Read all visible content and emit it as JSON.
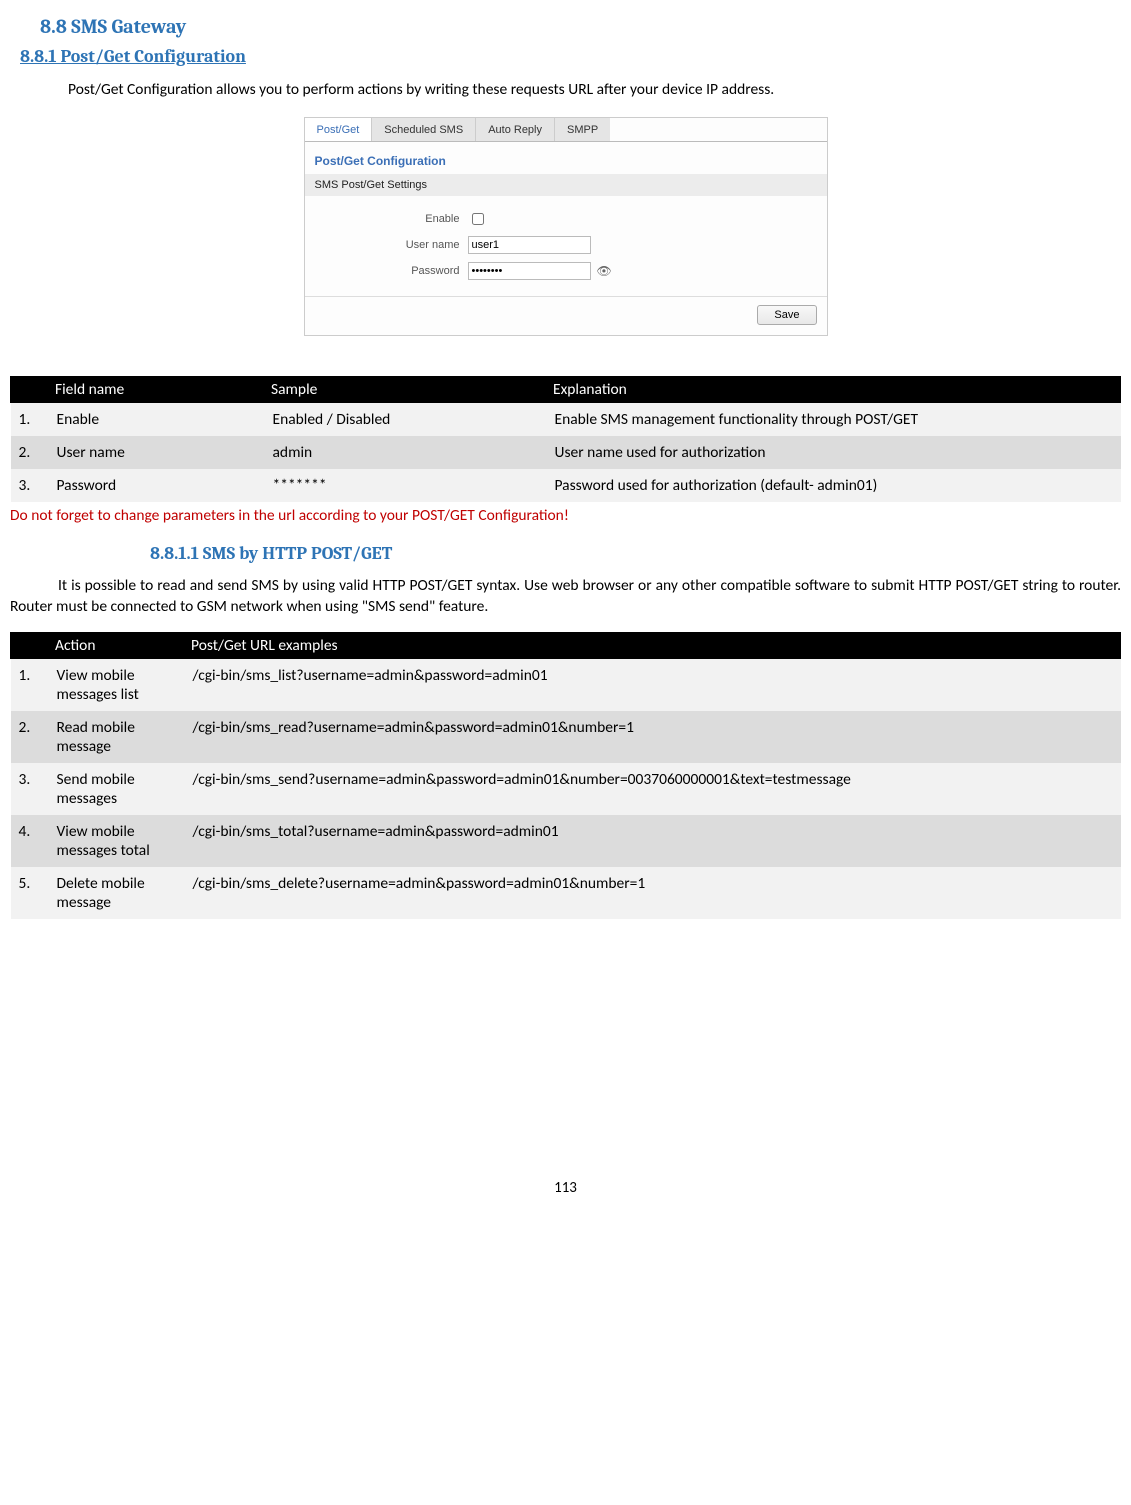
{
  "headings": {
    "h2": "8.8    SMS Gateway",
    "h3": "8.8.1  Post/Get Configuration",
    "p1": "Post/Get Configuration allows you to perform actions by writing these requests URL after your device IP address.",
    "h4": "8.8.1.1    SMS by HTTP POST/GET",
    "p2": "It is possible to read and send SMS by using valid HTTP POST/GET syntax. Use web browser or any other compatible software to submit HTTP POST/GET string to router. Router must be connected to GSM network when using \"SMS send\" feature.",
    "warning": "Do not forget to change parameters in the url according to your POST/GET Configuration!"
  },
  "screenshot": {
    "tabs": {
      "t1": "Post/Get",
      "t2": "Scheduled SMS",
      "t3": "Auto Reply",
      "t4": "SMPP"
    },
    "section_title": "Post/Get Configuration",
    "band": "SMS Post/Get Settings",
    "labels": {
      "enable": "Enable",
      "username": "User name",
      "password": "Password"
    },
    "values": {
      "username": "user1",
      "password": "••••••••"
    },
    "save": "Save"
  },
  "table1": {
    "headers": {
      "c1": "",
      "c2": "Field name",
      "c3": "Sample",
      "c4": "Explanation"
    },
    "rows": [
      {
        "n": "1.",
        "f": "Enable",
        "v": "Enabled / Disabled",
        "e": "Enable SMS management functionality through POST/GET"
      },
      {
        "n": "2.",
        "f": "User name",
        "v": "admin",
        "e": "User name used for authorization"
      },
      {
        "n": "3.",
        "f": "Password",
        "v": "*******",
        "e": "Password used for authorization (default- admin01)"
      }
    ]
  },
  "table2": {
    "headers": {
      "c1": "",
      "c2": "Action",
      "c3": "Post/Get URL examples"
    },
    "rows": [
      {
        "n": "1.",
        "a": "View mobile messages list",
        "u": "/cgi-bin/sms_list?username=admin&password=admin01"
      },
      {
        "n": "2.",
        "a": "Read mobile message",
        "u": "/cgi-bin/sms_read?username=admin&password=admin01&number=1"
      },
      {
        "n": "3.",
        "a": "Send mobile messages",
        "u": "/cgi-bin/sms_send?username=admin&password=admin01&number=0037060000001&text=testmessage"
      },
      {
        "n": "4.",
        "a": "View mobile messages total",
        "u": "/cgi-bin/sms_total?username=admin&password=admin01"
      },
      {
        "n": "5.",
        "a": "Delete mobile message",
        "u": "/cgi-bin/sms_delete?username=admin&password=admin01&number=1"
      }
    ]
  },
  "page_number": "113"
}
